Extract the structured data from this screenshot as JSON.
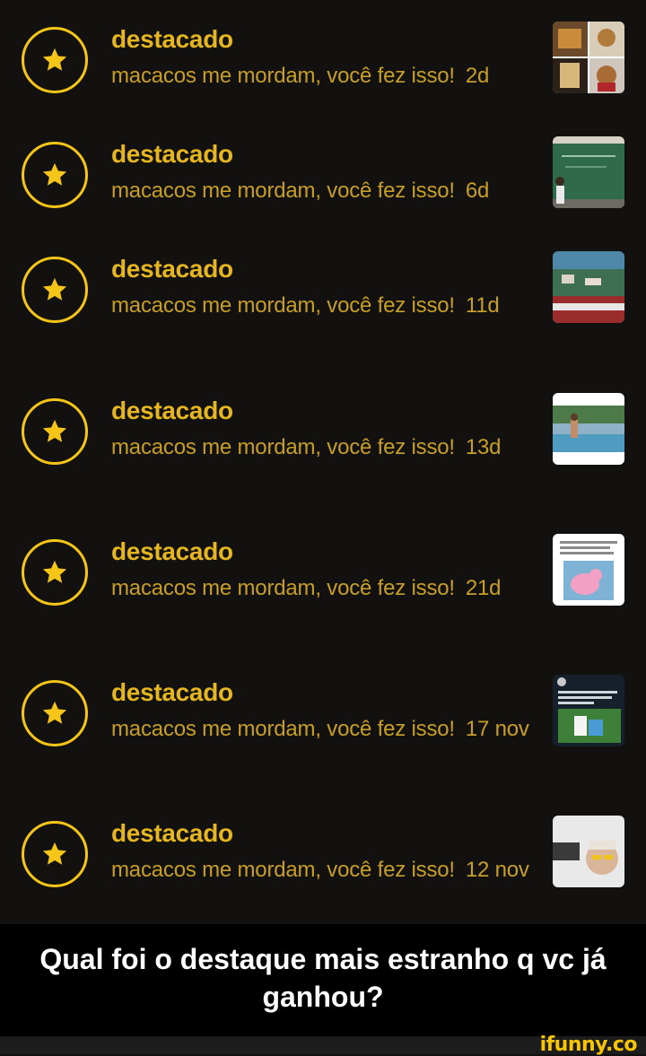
{
  "accent_color": "#f5c518",
  "title_color": "#e5b61f",
  "body_color": "#c79f26",
  "notifications": [
    {
      "icon": "star-icon",
      "title": "destacado",
      "message": "macacos me mordam, você fez isso!",
      "age": "2d"
    },
    {
      "icon": "star-icon",
      "title": "destacado",
      "message": "macacos me mordam, você fez isso!",
      "age": "6d"
    },
    {
      "icon": "star-icon",
      "title": "destacado",
      "message": "macacos me mordam, você fez isso!",
      "age": "11d"
    },
    {
      "icon": "star-icon",
      "title": "destacado",
      "message": "macacos me mordam, você fez isso!",
      "age": "13d"
    },
    {
      "icon": "star-icon",
      "title": "destacado",
      "message": "macacos me mordam, você fez isso!",
      "age": "21d"
    },
    {
      "icon": "star-icon",
      "title": "destacado",
      "message": "macacos me mordam, você fez isso!",
      "age": "17 nov"
    },
    {
      "icon": "star-icon",
      "title": "destacado",
      "message": "macacos me mordam, você fez isso!",
      "age": "12 nov"
    }
  ],
  "caption": "Qual foi o destaque mais estranho q vc já ganhou?",
  "watermark": "ifunny.co"
}
